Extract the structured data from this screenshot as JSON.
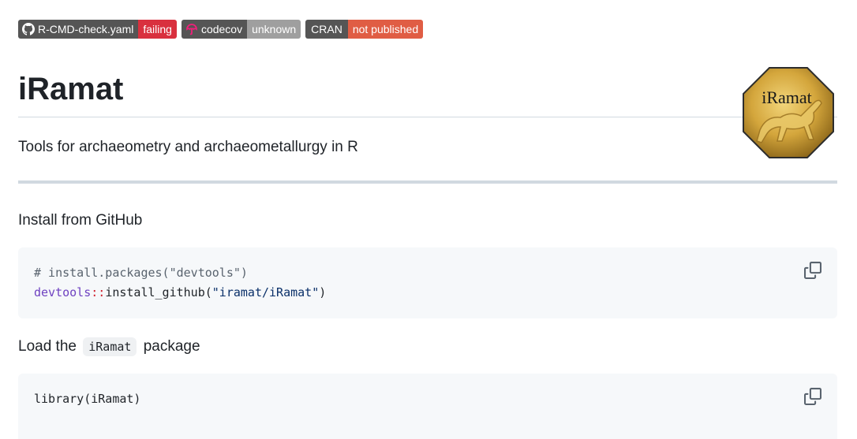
{
  "badges": [
    {
      "label": "R-CMD-check.yaml",
      "status": "failing",
      "status_color": "#d9303e",
      "icon": "github-icon"
    },
    {
      "label": "codecov",
      "status": "unknown",
      "status_color": "#9f9f9f",
      "icon": "codecov-umbrella-icon"
    },
    {
      "label": "CRAN",
      "status": "not published",
      "status_color": "#e05d44",
      "icon": ""
    }
  ],
  "header": {
    "title": "iRamat"
  },
  "logo": {
    "text": "iRamat",
    "icon": "coin-horse-logo"
  },
  "description": "Tools for archaeometry and archaeometallurgy in R",
  "install": {
    "heading": "Install from GitHub",
    "code": {
      "line1": "# install.packages(\"devtools\")",
      "line2_ns": "devtools",
      "line2_op": "::",
      "line2_fn": "install_github(",
      "line2_str": "\"iramat/iRamat\"",
      "line2_end": ")"
    }
  },
  "load": {
    "prefix": "Load the",
    "code_inline": "iRamat",
    "suffix": "package",
    "code": "library(iRamat)"
  },
  "colors": {
    "border": "#d1d9e0",
    "code_bg": "#f6f8fa"
  }
}
